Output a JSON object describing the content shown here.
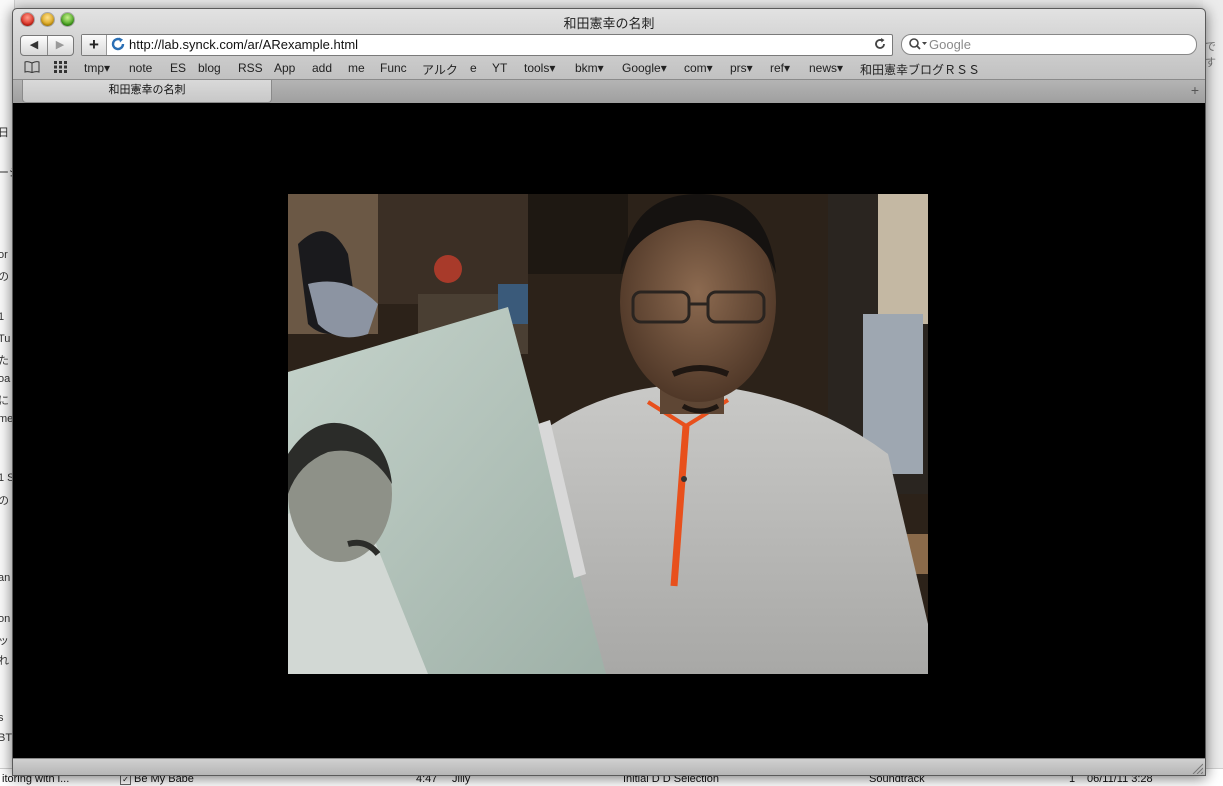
{
  "window": {
    "title": "和田憲幸の名刺",
    "url": "http://lab.synck.com/ar/ARexample.html",
    "search_placeholder": "Google",
    "tab_title": "和田憲幸の名刺",
    "new_tab": "+"
  },
  "nav": {
    "back": "◀",
    "forward": "▶",
    "add": "+"
  },
  "bookmarks": [
    {
      "label": "tmp▾"
    },
    {
      "label": "note"
    },
    {
      "label": "ES"
    },
    {
      "label": "blog"
    },
    {
      "label": "RSS"
    },
    {
      "label": "App"
    },
    {
      "label": "add"
    },
    {
      "label": "me"
    },
    {
      "label": "Func"
    },
    {
      "label": "アルク"
    },
    {
      "label": "e"
    },
    {
      "label": "YT"
    },
    {
      "label": "tools▾"
    },
    {
      "label": "bkm▾"
    },
    {
      "label": "Google▾"
    },
    {
      "label": "com▾"
    },
    {
      "label": "prs▾"
    },
    {
      "label": "ref▾"
    },
    {
      "label": "news▾"
    },
    {
      "label": "和田憲幸ブログＲＳＳ"
    }
  ],
  "background": {
    "left_fragments": [
      "日",
      "ーシ",
      "or",
      "の",
      "1",
      "Tu",
      "た",
      "oa",
      "に",
      "me",
      "1 S",
      "の",
      "an",
      "on",
      "ッ",
      "れ",
      "s",
      "BT"
    ],
    "right_fragment": "です",
    "bottom_row": {
      "left_text": "itoring with i...",
      "song": "Be My Babe",
      "time": "4:47",
      "artist": "Jilly",
      "album": "Initial D D Selection",
      "genre": "Soundtrack",
      "count": "1",
      "date": "06/11/11 3:28"
    }
  },
  "colors": {
    "content_bg": "#000000",
    "zipper_accent": "#e8501c"
  }
}
